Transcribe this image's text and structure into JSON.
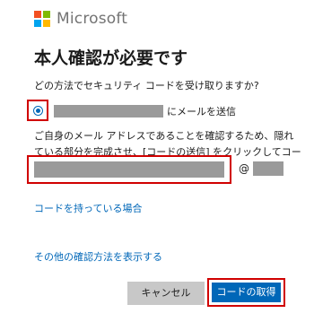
{
  "brand": {
    "name": "Microsoft",
    "logo_colors": [
      "#f25022",
      "#7fba00",
      "#00a4ef",
      "#ffb900"
    ]
  },
  "heading": "本人確認が必要です",
  "question": "どの方法でセキュリティ コードを受け取りますか?",
  "option": {
    "send_label": "にメールを送信",
    "selected": true
  },
  "instruction": "ご自身のメール アドレスであることを確認するため、隠れている部分を完成させ、[コードの送信] をクリックしてコードを受け取ってください。",
  "email": {
    "at": "@"
  },
  "links": {
    "have_code": "コードを持っている場合",
    "other_methods": "その他の確認方法を表示する"
  },
  "buttons": {
    "cancel": "キャンセル",
    "get_code": "コードの取得"
  },
  "colors": {
    "accent": "#0067b8",
    "highlight": "#d00000",
    "mask": "#9a9a9a"
  }
}
